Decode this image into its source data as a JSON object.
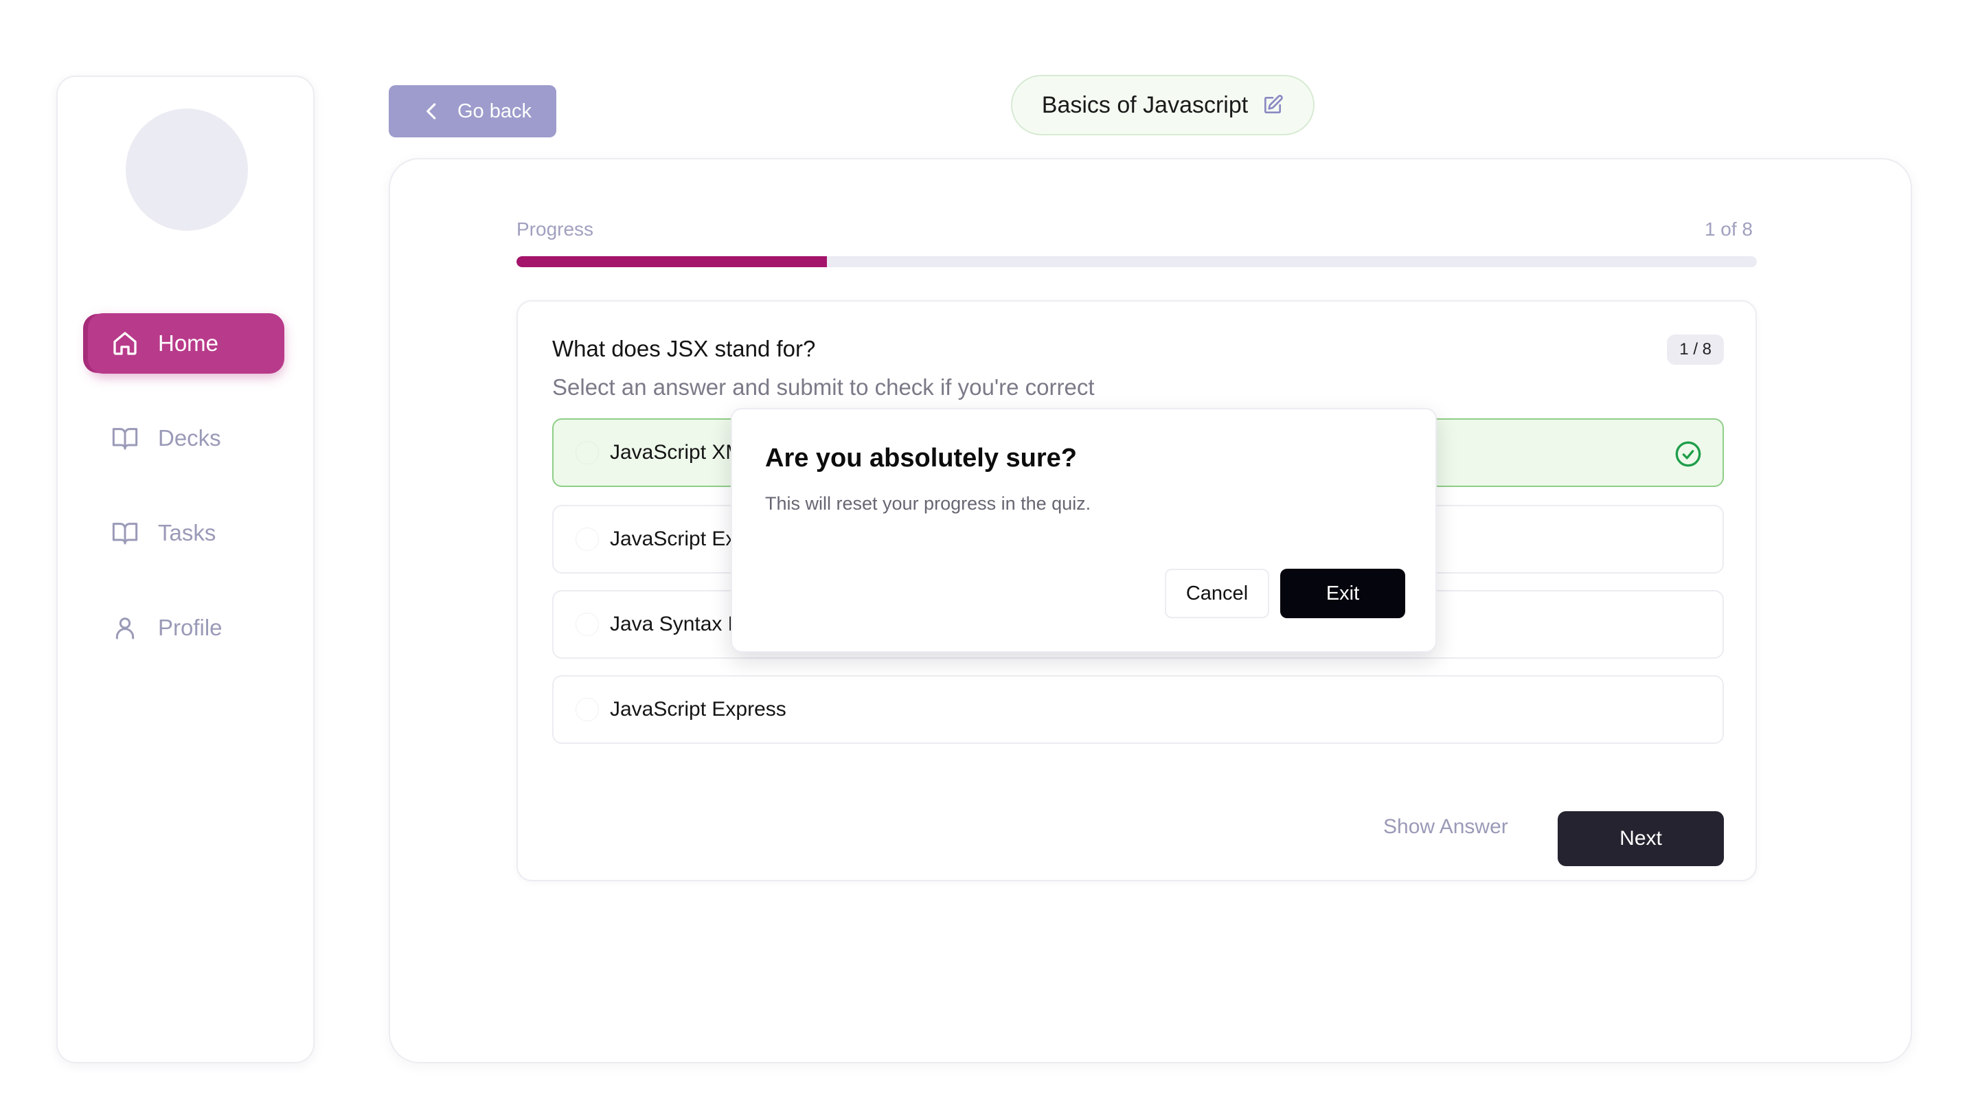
{
  "sidebar": {
    "items": [
      {
        "label": "Home",
        "icon": "home-icon",
        "active": true
      },
      {
        "label": "Decks",
        "icon": "book-icon",
        "active": false
      },
      {
        "label": "Tasks",
        "icon": "book-icon",
        "active": false
      },
      {
        "label": "Profile",
        "icon": "user-icon",
        "active": false
      }
    ]
  },
  "header": {
    "go_back_label": "Go back",
    "deck_title": "Basics of Javascript",
    "edit_icon": "edit-icon"
  },
  "progress": {
    "label": "Progress",
    "count_text": "1 of 8",
    "fraction": 0.25
  },
  "question": {
    "title": "What does JSX stand for?",
    "subtitle": "Select an answer and submit to check if you're correct",
    "badge": "1 / 8",
    "options": [
      {
        "label": "JavaScript XML",
        "selected": true
      },
      {
        "label": "JavaScript Extension",
        "selected": false
      },
      {
        "label": "Java Syntax Extension",
        "selected": false
      },
      {
        "label": "JavaScript Express",
        "selected": false
      }
    ],
    "show_answer_label": "Show Answer",
    "next_label": "Next"
  },
  "dialog": {
    "title": "Are you absolutely sure?",
    "description": "This will reset your progress in the quiz.",
    "cancel_label": "Cancel",
    "exit_label": "Exit"
  },
  "colors": {
    "accent": "#b83a8a",
    "progress_fill": "#a4146a",
    "success": "#1e9e4a",
    "go_back_bg": "#9d9ccc",
    "next_bg": "#24232f"
  }
}
